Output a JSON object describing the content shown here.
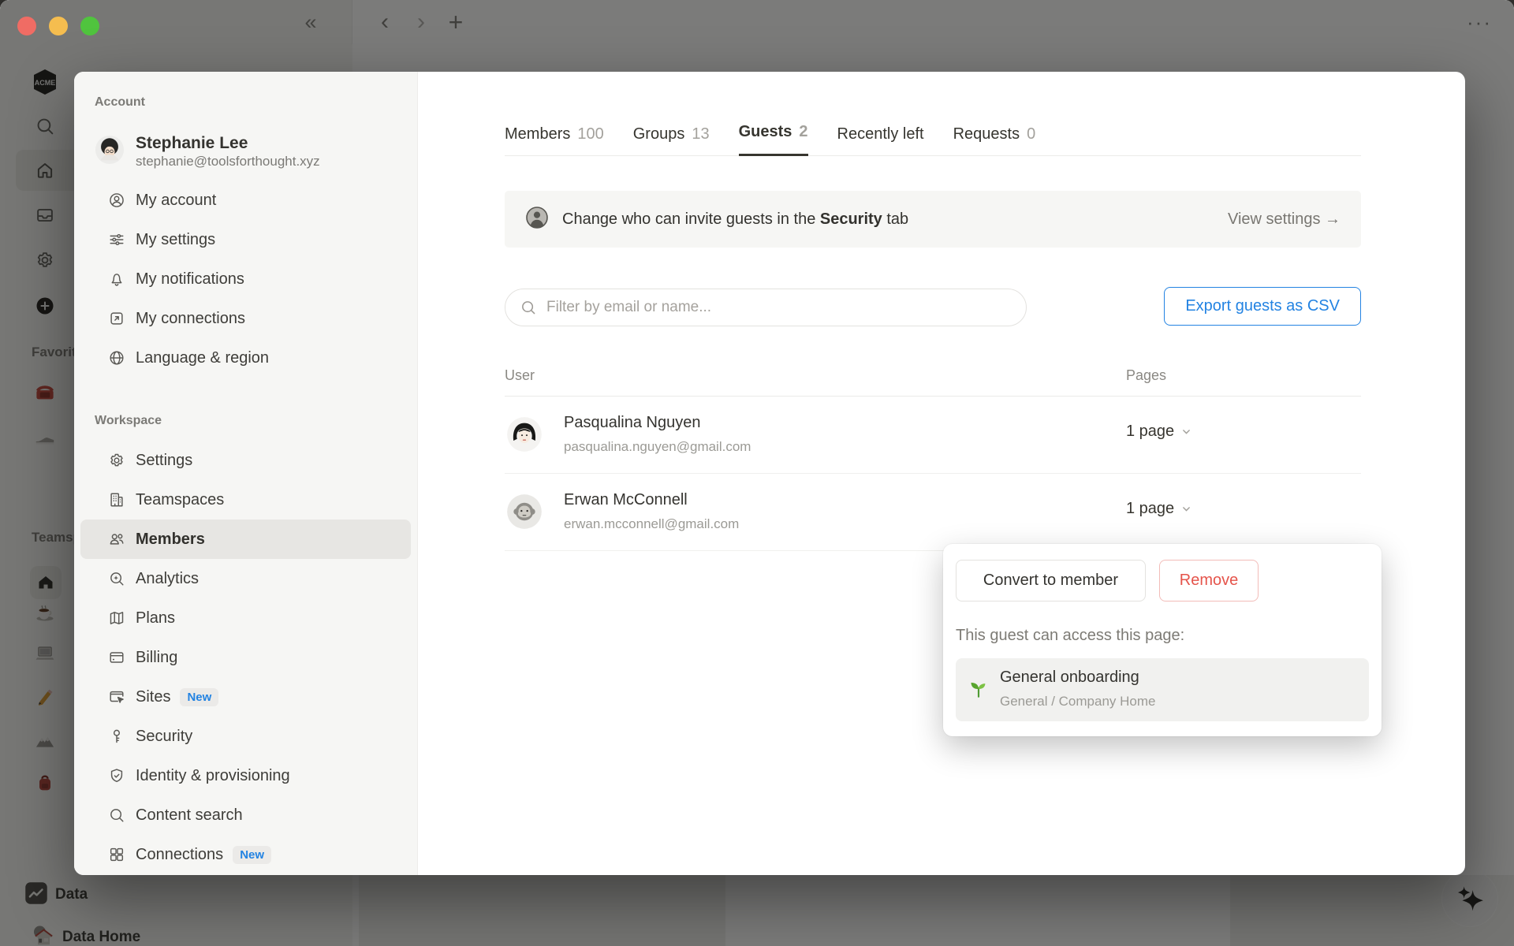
{
  "window": {
    "collapse_icon": "«",
    "back_icon": "‹",
    "forward_icon": "›",
    "new_tab_icon": "+",
    "more_icon": "···"
  },
  "app_background": {
    "workspace_logo_text": "ACME",
    "favorites_label": "Favorites",
    "teamspaces_label": "Teamspaces",
    "data_item_label": "Data",
    "data_home_label": "Data Home"
  },
  "settings_nav": {
    "account_label": "Account",
    "user": {
      "name": "Stephanie Lee",
      "email": "stephanie@toolsforthought.xyz"
    },
    "account_items": [
      {
        "label": "My account"
      },
      {
        "label": "My settings"
      },
      {
        "label": "My notifications"
      },
      {
        "label": "My connections"
      },
      {
        "label": "Language & region"
      }
    ],
    "workspace_label": "Workspace",
    "workspace_items": [
      {
        "label": "Settings"
      },
      {
        "label": "Teamspaces"
      },
      {
        "label": "Members",
        "selected": true
      },
      {
        "label": "Analytics"
      },
      {
        "label": "Plans"
      },
      {
        "label": "Billing"
      },
      {
        "label": "Sites",
        "badge": "New"
      },
      {
        "label": "Security"
      },
      {
        "label": "Identity & provisioning"
      },
      {
        "label": "Content search"
      },
      {
        "label": "Connections",
        "badge": "New"
      }
    ]
  },
  "members_page": {
    "tabs": [
      {
        "label": "Members",
        "count": "100"
      },
      {
        "label": "Groups",
        "count": "13"
      },
      {
        "label": "Guests",
        "count": "2",
        "active": true
      },
      {
        "label": "Recently left",
        "count": ""
      },
      {
        "label": "Requests",
        "count": "0"
      }
    ],
    "banner": {
      "text_before": "Change who can invite guests in the ",
      "text_bold": "Security",
      "text_after": " tab",
      "action_label": "View settings →"
    },
    "filter_placeholder": "Filter by email or name...",
    "export_button_label": "Export guests as CSV",
    "table": {
      "col_user": "User",
      "col_pages": "Pages",
      "rows": [
        {
          "name": "Pasqualina Nguyen",
          "email": "pasqualina.nguyen@gmail.com",
          "pages": "1 page"
        },
        {
          "name": "Erwan McConnell",
          "email": "erwan.mcconnell@gmail.com",
          "pages": "1 page"
        }
      ]
    }
  },
  "guest_popup": {
    "convert_label": "Convert to member",
    "remove_label": "Remove",
    "access_text": "This guest can access this page:",
    "page_title": "General onboarding",
    "page_path": "General / Company Home"
  },
  "colors": {
    "accent_blue": "#2383e2",
    "danger_red": "#eb5757",
    "selected_bg": "#e7e6e3",
    "panel_bg": "#f6f6f4"
  }
}
